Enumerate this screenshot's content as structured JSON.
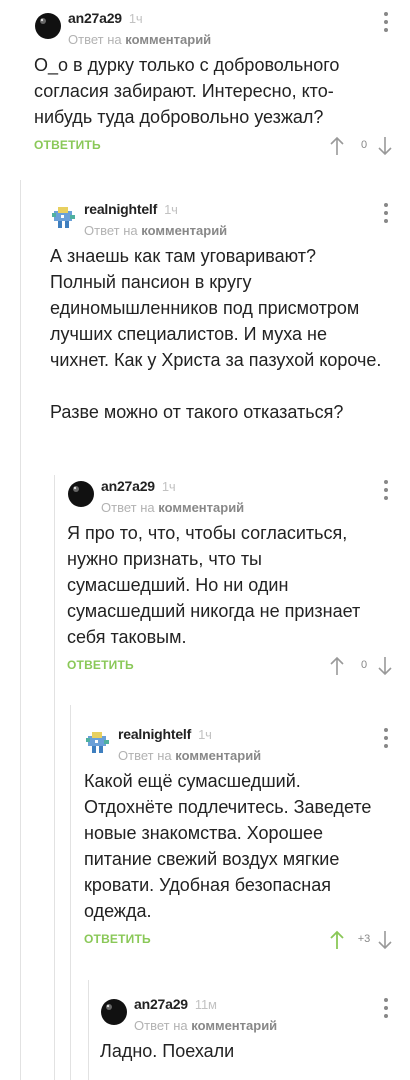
{
  "reply_to_prefix": "Ответ на",
  "reply_to_target": "комментарий",
  "reply_label": "ОТВЕТИТЬ",
  "colors": {
    "accent": "#8ac858",
    "muted": "#b2b2b2",
    "thread_line": "#e2e2e2"
  },
  "comments": [
    {
      "author": "an27a29",
      "time": "1ч",
      "avatar_icon": "black-ball-avatar-icon",
      "text": "О_о в дурку только с добровольного согласия забирают. Интересно, кто-нибудь туда добровольно уезжал?",
      "rating": "0",
      "upvoted": false
    },
    {
      "author": "realnightelf",
      "time": "1ч",
      "avatar_icon": "pixel-character-avatar-icon",
      "text": "А знаешь как там уговаривают? Полный пансион в кругу единомышленников под присмотром лучших специалистов. И муха не чихнет. Как у Христа за пазухой короче.\n\nРазве можно от такого отказаться?",
      "rating": null,
      "upvoted": false
    },
    {
      "author": "an27a29",
      "time": "1ч",
      "avatar_icon": "black-ball-avatar-icon",
      "text": "Я про то, что, чтобы согласиться, нужно признать, что ты сумасшедший. Но ни один сумасшедший никогда не признает себя таковым.",
      "rating": "0",
      "upvoted": false
    },
    {
      "author": "realnightelf",
      "time": "1ч",
      "avatar_icon": "pixel-character-avatar-icon",
      "text": "Какой ещё сумасшедший. Отдохнёте подлечитесь. Заведете новые знакомства. Хорошее питание свежий воздух мягкие кровати. Удобная безопасная одежда.",
      "rating": "+3",
      "upvoted": true
    },
    {
      "author": "an27a29",
      "time": "11м",
      "avatar_icon": "black-ball-avatar-icon",
      "text": "Ладно. Поехали",
      "rating": null,
      "upvoted": false
    }
  ]
}
